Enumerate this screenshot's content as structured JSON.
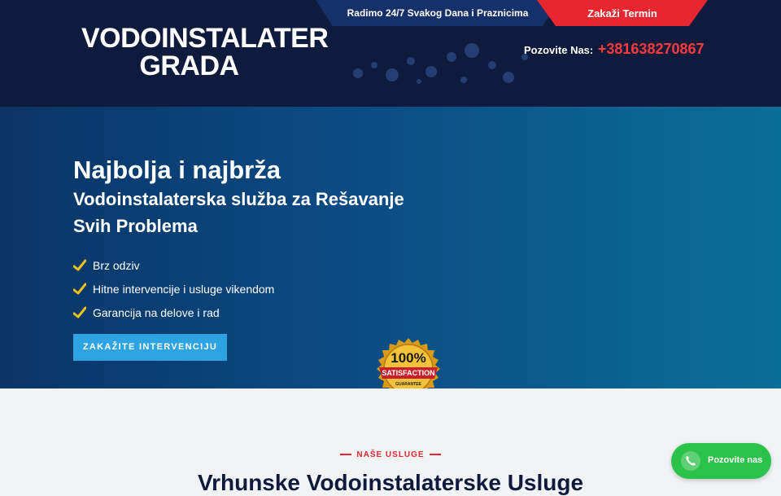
{
  "header": {
    "logo_line1": "VODOINSTALATER",
    "logo_line2": "GRADA",
    "topbar_text": "Radimo 24/7 Svakog Dana i Praznicima",
    "cta_label": "Zakaži Termin",
    "call_label": "Pozovite Nas:",
    "phone": "+381638270867"
  },
  "hero": {
    "title": "Najbolja i najbrža",
    "subtitle": "Vodoinstalaterska služba za Rešavanje Svih Problema",
    "features": [
      "Brz odziv",
      "Hitne intervencije i usluge vikendom",
      "Garancija na delove i rad"
    ],
    "button_label": "ZAKAŽITE INTERVENCIJU",
    "badge_big": "100%",
    "badge_band": "SATISFACTION",
    "badge_small": "GUARANTEE"
  },
  "services": {
    "eyebrow": "NAŠE USLUGE",
    "title": "Vrhunske Vodoinstalaterske Usluge"
  },
  "float_call": {
    "label": "Pozovite nas"
  },
  "colors": {
    "navy": "#0f1b3d",
    "red": "#e8262f",
    "button_blue": "#2ea3e2",
    "green": "#2bc24a",
    "check_yellow": "#f4c21b"
  }
}
